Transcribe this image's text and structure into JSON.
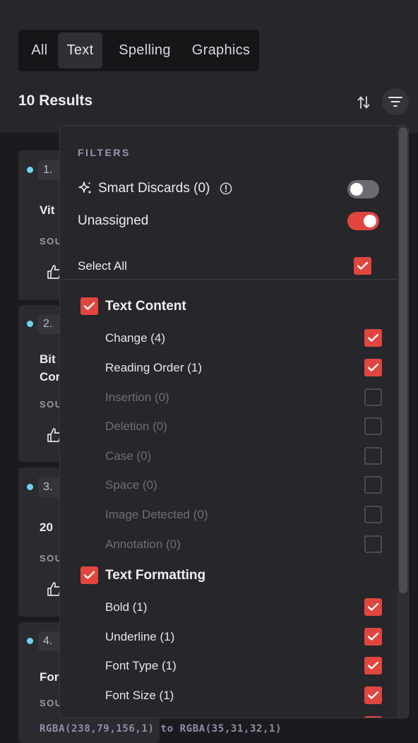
{
  "tabs": [
    {
      "label": "All",
      "active": false
    },
    {
      "label": "Text",
      "active": true
    },
    {
      "label": "Spelling",
      "active": false
    },
    {
      "label": "Graphics",
      "active": false
    }
  ],
  "results_count": "10 Results",
  "cards": [
    {
      "number": "1.",
      "title": "Vit",
      "source": "SOU"
    },
    {
      "number": "2.",
      "title_lines": [
        "Bit",
        "Cor"
      ],
      "source": "SOU"
    },
    {
      "number": "3.",
      "title": "20",
      "source": "SOU"
    },
    {
      "number": "4.",
      "title": "For",
      "source": "SOU"
    }
  ],
  "rgba_line": "RGBA(238,79,156,1) to RGBA(35,31,32,1)",
  "filters": {
    "heading": "FILTERS",
    "smart_discards_label": "Smart Discards (0)",
    "smart_discards_on": false,
    "unassigned_label": "Unassigned",
    "unassigned_on": true,
    "select_all_label": "Select All",
    "select_all_checked": true,
    "groups": [
      {
        "title": "Text Content",
        "checked": true,
        "items": [
          {
            "label": "Change (4)",
            "checked": true,
            "enabled": true
          },
          {
            "label": "Reading Order (1)",
            "checked": true,
            "enabled": true
          },
          {
            "label": "Insertion (0)",
            "checked": false,
            "enabled": false
          },
          {
            "label": "Deletion (0)",
            "checked": false,
            "enabled": false
          },
          {
            "label": "Case (0)",
            "checked": false,
            "enabled": false
          },
          {
            "label": "Space (0)",
            "checked": false,
            "enabled": false
          },
          {
            "label": "Image Detected (0)",
            "checked": false,
            "enabled": false
          },
          {
            "label": "Annotation (0)",
            "checked": false,
            "enabled": false
          }
        ]
      },
      {
        "title": "Text Formatting",
        "checked": true,
        "items": [
          {
            "label": "Bold (1)",
            "checked": true,
            "enabled": true
          },
          {
            "label": "Underline (1)",
            "checked": true,
            "enabled": true
          },
          {
            "label": "Font Type (1)",
            "checked": true,
            "enabled": true
          },
          {
            "label": "Font Size (1)",
            "checked": true,
            "enabled": true
          }
        ]
      }
    ]
  },
  "colors": {
    "accent": "#e0463e",
    "dot": "#6fd3ef",
    "panel_bg": "#26262b"
  }
}
